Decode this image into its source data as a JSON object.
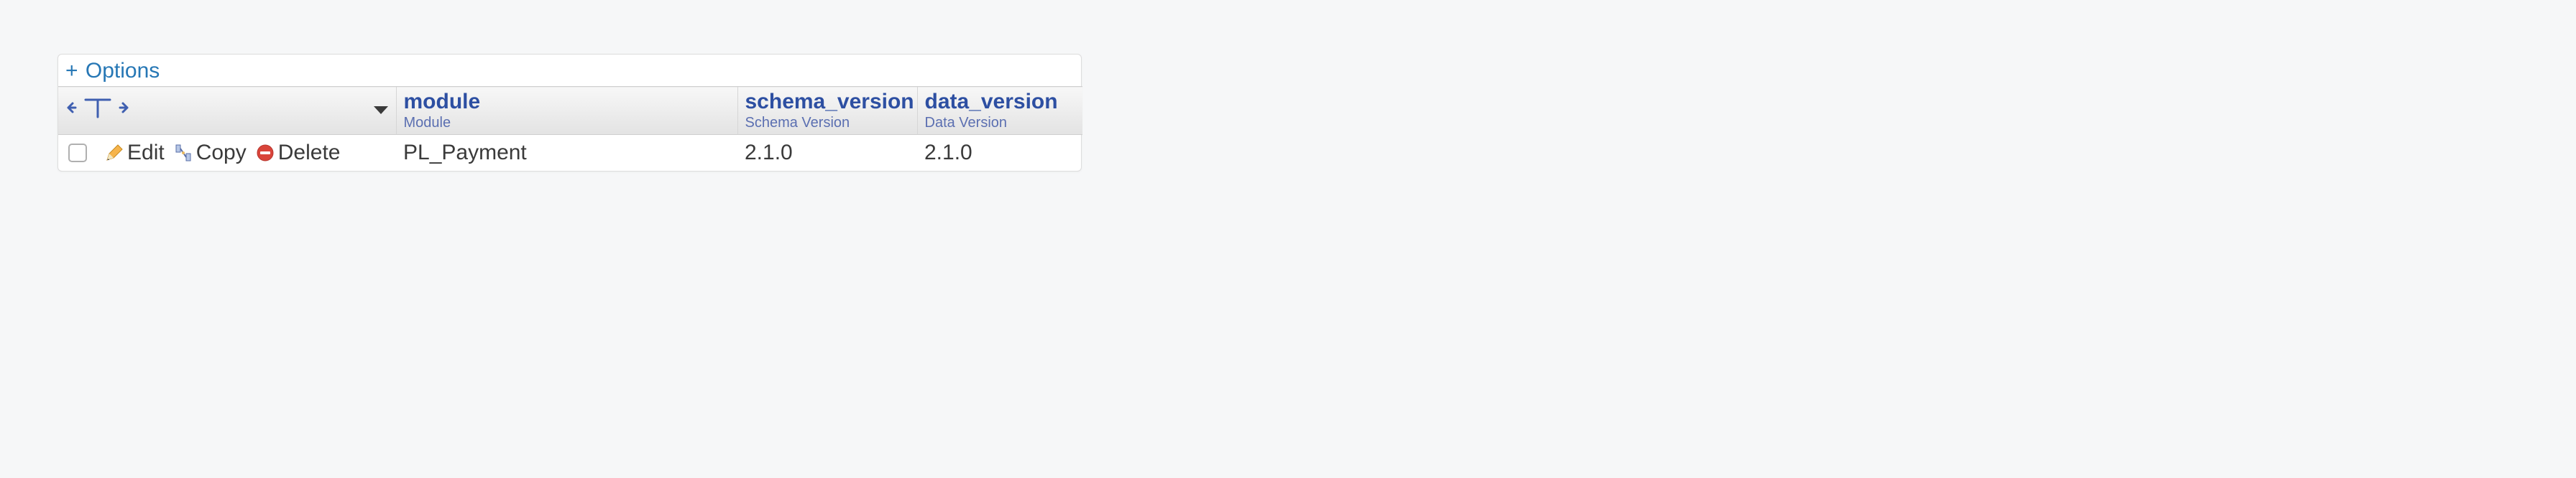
{
  "options_label": "Options",
  "columns": {
    "module": {
      "title": "module",
      "sub": "Module"
    },
    "schema": {
      "title": "schema_version",
      "sub": "Schema Version"
    },
    "data": {
      "title": "data_version",
      "sub": "Data Version"
    }
  },
  "actions": {
    "edit": "Edit",
    "copy": "Copy",
    "delete": "Delete"
  },
  "rows": [
    {
      "module": "PL_Payment",
      "schema_version": "2.1.0",
      "data_version": "2.1.0"
    }
  ]
}
